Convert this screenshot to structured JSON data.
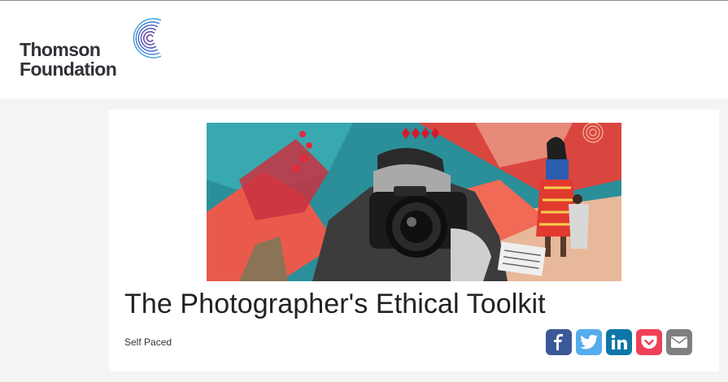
{
  "brand": {
    "name_line1": "Thomson",
    "name_line2": "Foundation"
  },
  "course": {
    "title": "The Photographer's Ethical Toolkit",
    "pace": "Self Paced"
  },
  "share": {
    "items": [
      {
        "icon": "facebook-icon",
        "glyph": "f",
        "color": "#3b5998"
      },
      {
        "icon": "twitter-icon",
        "glyph": "",
        "color": "#55acee"
      },
      {
        "icon": "linkedin-icon",
        "glyph": "in",
        "color": "#0e76a8"
      },
      {
        "icon": "pocket-icon",
        "glyph": "",
        "color": "#ee4056"
      },
      {
        "icon": "email-icon",
        "glyph": "",
        "color": "#7f7f7f"
      }
    ]
  },
  "colors": {
    "header_bg": "#ffffff",
    "page_bg": "#f4f4f4",
    "logo_text": "#2f3236",
    "logo_accent": "#3aa1d9"
  }
}
